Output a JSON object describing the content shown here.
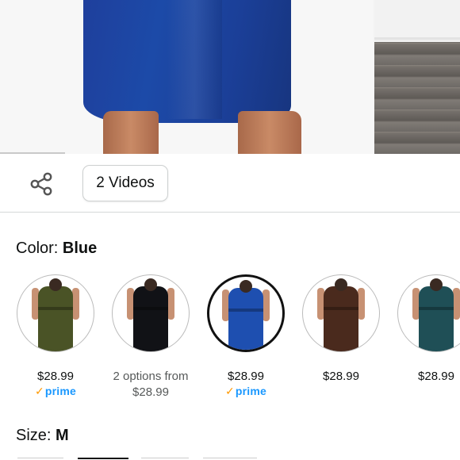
{
  "gallery": {
    "main_image_alt": "Blue dress model photo",
    "side_image_alt": "Room floor photo"
  },
  "actions": {
    "share_icon": "share-icon",
    "videos_label": "2 Videos"
  },
  "color": {
    "label": "Color: ",
    "selected": "Blue",
    "options": [
      {
        "color": "#4a5326",
        "price": "$28.99",
        "prime": true,
        "selected": false
      },
      {
        "color": "#111216",
        "price_line1": "2 options from",
        "price_line2": "$28.99",
        "prime": false,
        "selected": false
      },
      {
        "color": "#1e4fb0",
        "price": "$28.99",
        "prime": true,
        "selected": true
      },
      {
        "color": "#4a2a1d",
        "price": "$28.99",
        "prime": false,
        "selected": false
      },
      {
        "color": "#1f4f56",
        "price": "$28.99",
        "prime": false,
        "selected": false
      }
    ]
  },
  "prime_badge": {
    "check": "✓",
    "text": "prime"
  },
  "size": {
    "label": "Size: ",
    "selected": "M"
  },
  "colors": {
    "prime_blue": "#1a98ff",
    "prime_check": "#ff9900",
    "divider": "#d5d9d9"
  }
}
